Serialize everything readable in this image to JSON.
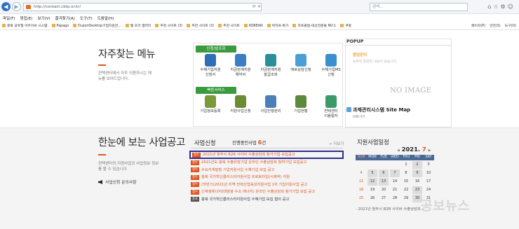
{
  "browser": {
    "url": "http://contact.cbtp.or.kr/",
    "tab_title": "충북테크노파크 전략산업...",
    "search_placeholder": "검색...",
    "menu": [
      "파일(F)",
      "편집(E)",
      "보기(V)",
      "즐겨찾기(A)",
      "도구(T)",
      "도움말(H)"
    ],
    "favorites": [
      "충북 공유형 아카이브 시스템",
      "Papago",
      "DuzonDesktop기업지원관...",
      "웹 조각 갤러리",
      "추천 사이트 (3)",
      "추천 사이트 (3)",
      "추천 사이트",
      "KOREAN",
      "위하프-특가",
      "하프클럽-대선전문몰 NO.1",
      "쿠팡"
    ],
    "fav_right": [
      "페이지(P)",
      "안전(S)",
      "도구(O)"
    ]
  },
  "freq": {
    "title": "자주찾는 메뉴",
    "desc": "컨택센터에서 자주 이용하시는 메뉴를 보여드립니다."
  },
  "services": {
    "tag1": "신청/발조회",
    "tag2": "빠른서비스",
    "row1": [
      {
        "label": "수혜기업지원\n신청서",
        "icon": "document-icon",
        "color": "#2f6fb5"
      },
      {
        "label": "지금현계지원\n예약서",
        "icon": "document-stack-icon",
        "color": "#3b7ec6"
      },
      {
        "label": "지금현계지원\n발급조회",
        "icon": "coin-icon",
        "color": "#2b8f9a"
      },
      {
        "label": "애로상담신청",
        "icon": "chat-icon",
        "color": "#4b9fd6"
      },
      {
        "label": "수혜기업MS\n신청",
        "icon": "phone-icon",
        "color": "#3a8fd0"
      }
    ],
    "row2": [
      {
        "label": "기업정보등록",
        "icon": "folder-icon",
        "color": "#7a9a3a"
      },
      {
        "label": "지원사업신청",
        "icon": "clipboard-icon",
        "color": "#6b8c32"
      },
      {
        "label": "사업진행관리",
        "icon": "monitor-icon",
        "color": "#4a7fb8"
      },
      {
        "label": "기업현황",
        "icon": "building-icon",
        "color": "#5a8a3a"
      },
      {
        "label": "컨택센터\n이용절차",
        "icon": "flow-icon",
        "color": "#3a9a6a"
      }
    ]
  },
  "popup": {
    "title": "POPUP",
    "sub": "팝업존이",
    "sub2": "등록된 팝업존 내용이 없습니다.",
    "no_image": "NO IMAGE",
    "foot": "과제관리시스템 Site Map",
    "foot2": "바로가기"
  },
  "biz": {
    "title": "한눈에 보는 사업공고",
    "desc": "컨택센터의 지원사업과 사업정보 정보를 볼 수 있습니다",
    "inquiry": "사업신청 문의사항"
  },
  "apply": {
    "title": "사업신청",
    "count_prefix": "진행중인사업",
    "count": "6",
    "count_suffix": "건",
    "more": "+ 더보기",
    "items": [
      {
        "badge": "접수",
        "text": "2021년 청주시 B2B 사이버 수출상담회 참가기업 모집공고",
        "closed": false,
        "highlighted": true
      },
      {
        "badge": "접수",
        "text": "2021년도 충북 수출유망기업 온라인 수출상담회 참여기업 모집공고",
        "closed": false,
        "highlighted": false
      },
      {
        "badge": "접수",
        "text": "수요자개발형 기업지원사업 수혜기업 모집 공고",
        "closed": false,
        "highlighted": false
      },
      {
        "badge": "접수",
        "text": "충북 국가혁신클러스터지원사업 프로토타입(시제작) 지원",
        "closed": false,
        "highlighted": false
      },
      {
        "badge": "접수",
        "text": "(하반기)2021년 지역 전략산업육성지원사업 1차 기업지원사업 공고",
        "closed": false,
        "highlighted": false
      },
      {
        "badge": "접수",
        "text": "신재생에너지(태양광·수소 에너지) 온라인 수출상담회 참가기업 모집 공고",
        "closed": false,
        "highlighted": false
      },
      {
        "badge": "종료",
        "text": "충북 국가혁신클러스터지원사업 수혜기업 모집 협의 공고",
        "closed": true,
        "highlighted": false
      }
    ]
  },
  "calendar": {
    "title": "지원사업일정",
    "year": "2021.",
    "month": "7",
    "prev": "◀",
    "next": "▶",
    "headers": [
      "SUN",
      "MON",
      "TUE",
      "WED",
      "THU",
      "FRI",
      "SAT"
    ],
    "weeks": [
      [
        "",
        "",
        "",
        "",
        "1",
        "2",
        "3"
      ],
      [
        "4",
        "5",
        "6",
        "7",
        "8",
        "9",
        "10"
      ],
      [
        "11",
        "12",
        "13",
        "14",
        "15",
        "16",
        "17"
      ],
      [
        "18",
        "19",
        "20",
        "21",
        "22",
        "23",
        "24"
      ],
      [
        "25",
        "26",
        "27",
        "28",
        "29",
        "30",
        "31"
      ]
    ],
    "highlighted": [
      "2",
      "5",
      "6",
      "7",
      "9",
      "12",
      "13",
      "23",
      "30"
    ],
    "note": "· 2021년 청주시 B2B 사이버 수출상담회..."
  },
  "watermark": "공보뉴스"
}
